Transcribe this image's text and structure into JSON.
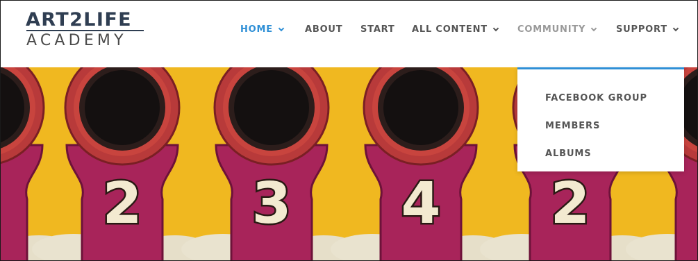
{
  "logo": {
    "line1": "ART2LIFE",
    "line2": "ACADEMY"
  },
  "nav": {
    "home": "HOME",
    "about": "ABOUT",
    "start": "START",
    "all_content": "ALL CONTENT",
    "community": "COMMUNITY",
    "support": "SUPPORT"
  },
  "community_menu": {
    "items": [
      "FACEBOOK GROUP",
      "MEMBERS",
      "ALBUMS"
    ]
  },
  "hero": {
    "numbers": [
      "2",
      "3",
      "4",
      "2"
    ]
  },
  "colors": {
    "accent": "#2e8fd6",
    "nav_text": "#555555",
    "nav_muted": "#9a9a9a",
    "logo": "#2f3e52",
    "hero_yellow": "#f0b820",
    "hero_magenta": "#a8245a",
    "hero_red": "#c8443e",
    "hero_cream": "#f3ead0"
  }
}
